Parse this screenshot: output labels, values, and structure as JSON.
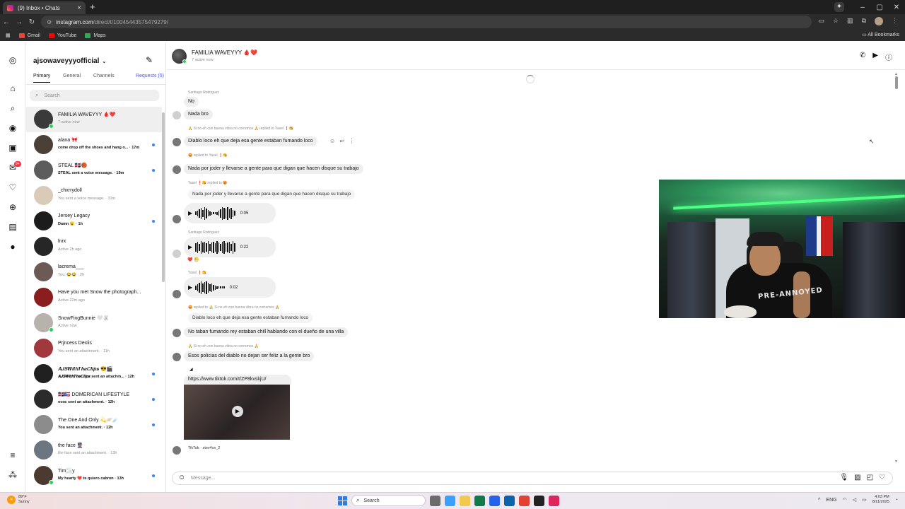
{
  "browser": {
    "tab_title": "(9) Inbox • Chats",
    "url_domain": "instagram.com",
    "url_path": "/direct/t/100454435754792​79/",
    "bookmarks": [
      {
        "label": "Gmail",
        "color": "#ea4335"
      },
      {
        "label": "YouTube",
        "color": "#ff0000"
      },
      {
        "label": "Maps",
        "color": "#34a853"
      }
    ],
    "all_bookmarks": "All Bookmarks"
  },
  "rail": {
    "notifications_badge": "9+"
  },
  "inbox": {
    "username": "ajsowaveyyyofficial",
    "tabs": [
      "Primary",
      "General",
      "Channels",
      "Requests (5)"
    ],
    "search_placeholder": "Search",
    "conversations": [
      {
        "name": "FAMILIA WAVEYYY 🩸❤️",
        "preview": "7 active now",
        "color": "#3a3a3a",
        "online": true,
        "unread": false,
        "selected": true
      },
      {
        "name": "alana 🎀",
        "preview": "come drop off the shoes and hang o... · 17m",
        "color": "#4a4038",
        "online": false,
        "unread": true,
        "selected": false
      },
      {
        "name": "STEAL 🇩🇴🏀",
        "preview": "STEAL sent a voice message. · 19m",
        "color": "#5c5c5c",
        "online": false,
        "unread": true,
        "selected": false
      },
      {
        "name": "_chxrrydoll",
        "preview": "You sent a voice message. · 31m",
        "color": "#d9cbb8",
        "online": false,
        "unread": false,
        "selected": false
      },
      {
        "name": "Jersey Legacy",
        "preview": "Damn 😮 · 1h",
        "color": "#1c1c1c",
        "online": false,
        "unread": true,
        "selected": false
      },
      {
        "name": "lnrx",
        "preview": "Active 2h ago",
        "color": "#262626",
        "online": false,
        "unread": false,
        "selected": false
      },
      {
        "name": "lacrema___",
        "preview": "You: 😂😂 · 2h",
        "color": "#6b5a55",
        "online": false,
        "unread": false,
        "selected": false
      },
      {
        "name": "Have you met Snow the photograph...",
        "preview": "Active 22m ago",
        "color": "#8a1d1d",
        "online": false,
        "unread": false,
        "selected": false
      },
      {
        "name": "SnowFingBunnie 🤍🐰",
        "preview": "Active now",
        "color": "#b8b2ad",
        "online": true,
        "unread": false,
        "selected": false
      },
      {
        "name": "Prjncess Dexiis",
        "preview": "You sent an attachment. · 11h",
        "color": "#a0383e",
        "online": false,
        "unread": false,
        "selected": false
      },
      {
        "name": "𝑨𝑱𝑺𝑾𝒊𝒕𝒉𝑻𝒉𝒆𝑪𝒍𝒊𝒑𝒔 😎🎬",
        "preview": "𝑨𝑱𝑺𝑾𝒊𝒕𝒉𝑻𝒉𝒆𝑪𝒍𝒊𝒑𝒔 sent an attachm... · 12h",
        "color": "#202020",
        "online": false,
        "unread": true,
        "selected": false
      },
      {
        "name": "🇩🇴🇵🇷 DOMERICAN LIFESTYLE",
        "preview": "οουε sent an attachment. · 12h",
        "color": "#2b2b2b",
        "online": false,
        "unread": true,
        "selected": false
      },
      {
        "name": "The One And Only 💫🪐☄️",
        "preview": "You sent an attachment. · 12h",
        "color": "#8c8c8c",
        "online": false,
        "unread": true,
        "selected": false
      },
      {
        "name": "the face 👮🏽",
        "preview": "the face sent an attachment. · 13h",
        "color": "#6d7680",
        "online": false,
        "unread": false,
        "selected": false
      },
      {
        "name": "Tim🌫️y",
        "preview": "My hearty ❤️ te quiero cabron · 13h",
        "color": "#4b3a30",
        "online": true,
        "unread": true,
        "selected": false
      }
    ]
  },
  "chat": {
    "group_name": "FAMILIA WAVEYYY 🩸❤️",
    "active_status": "7 active now",
    "messages": {
      "m1_sender": "Santiago Rodriguez",
      "m1_a": "No",
      "m1_b": "Nada bro",
      "m2_reply": "🙏 Si no eh con buena vibra no corremos 🙏 replied to Yasel ❗😘",
      "m2_text": "Diablo loco eh que deja esa gente estaban fumando loco",
      "m3_reply": "😡 replied to Yasel ❗😘",
      "m3_text": "Nada por joder y llevarse a gente para que digan que hacen disque su trabajo",
      "m4_reply": "Yasel ❗😘 replied to 😡",
      "m4_quote": "Nada por joder y llevarse a gente para que digan que hacen disque su trabajo",
      "v1_dur": "0:05",
      "v2_sender": "Santiago Rodriguez",
      "v2_dur": "0:22",
      "v2_reacts": "❤️ 😬",
      "v3_sender": "Yasel ❗😘",
      "v3_dur": "0:02",
      "m5_reply": "😡 replied to 🙏 Si no eh con buena vibra no corremos 🙏",
      "m5_quote": "Diablo loco eh que deja esa gente estaban fumando loco",
      "m5_text": "No taban fumando rey estaban chill hablando con el dueño de una villa",
      "m6_reply": "🙏 Si no eh con buena vibra no corremos 🙏",
      "m6_text": "Esos policias del diablo no dejan ser feliz a la gente bro",
      "tiktok_url": "https://www.tiktok.com/t/ZP8kvskjU/",
      "tiktok_caption": "TikTok · stev4xx_2"
    },
    "composer_placeholder": "Message..."
  },
  "webcam": {
    "shirt_text": "PRE-ANNOYED"
  },
  "taskbar": {
    "temp": "89°F",
    "condition": "Sunny",
    "search": "Search",
    "lang": "ENG",
    "time": "4:03 PM",
    "date": "8/11/2025"
  }
}
